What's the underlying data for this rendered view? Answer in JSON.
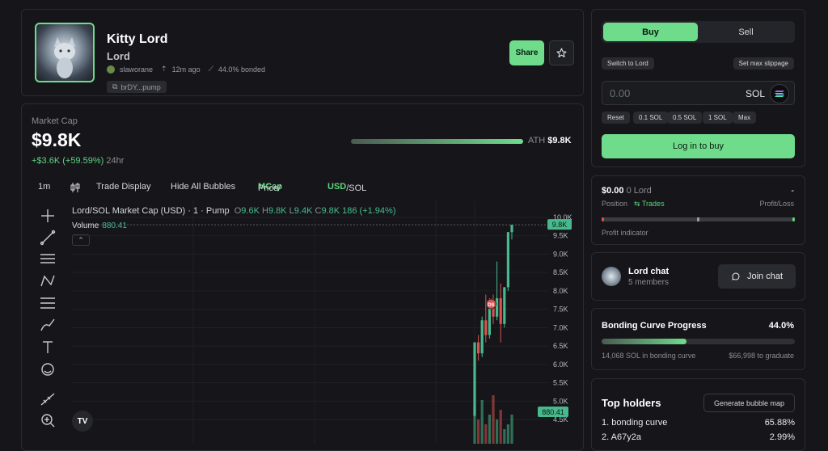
{
  "token": {
    "name": "Kitty Lord",
    "symbol": "Lord",
    "creator": "slaworane",
    "age": "12m ago",
    "bonded": "44.0% bonded",
    "address": "brDY...pump",
    "share_label": "Share"
  },
  "market": {
    "label": "Market Cap",
    "value": "$9.8K",
    "change": "+$3.6K (+59.59%)",
    "period": "24hr",
    "ath_label": "ATH",
    "ath_value": "$9.8K"
  },
  "toolbar": {
    "interval": "1m",
    "trade_display": "Trade Display",
    "hide_bubbles": "Hide All Bubbles",
    "price_label": "Price/",
    "mcap_label": "MCap",
    "usd_label": "USD",
    "sol_label": "/SOL"
  },
  "chart_data": {
    "type": "candlestick",
    "title": "Lord/SOL Market Cap (USD) · 1 · Pump",
    "ohlc": {
      "o_label": "O",
      "o": "9.6K",
      "h_label": "H",
      "h": "9.8K",
      "l_label": "L",
      "l": "9.4K",
      "c_label": "C",
      "c": "9.8K",
      "change": "186 (+1.94%)"
    },
    "volume_label": "Volume",
    "volume": "880.41",
    "y_ticks": [
      "10.0K",
      "9.5K",
      "9.0K",
      "8.5K",
      "8.0K",
      "7.5K",
      "7.0K",
      "6.5K",
      "6.0K",
      "5.5K",
      "5.0K",
      "4.5K"
    ],
    "y_min": 4.5,
    "y_max": 10.0,
    "last_price_tag": "9.8K",
    "volume_tag": "880.41",
    "bubble_label": "DS",
    "candles": [
      {
        "o": 4.6,
        "h": 6.6,
        "l": 4.6,
        "c": 6.6
      },
      {
        "o": 6.6,
        "h": 6.8,
        "l": 6.1,
        "c": 6.3
      },
      {
        "o": 6.3,
        "h": 7.3,
        "l": 6.2,
        "c": 7.2
      },
      {
        "o": 7.2,
        "h": 7.9,
        "l": 6.6,
        "c": 6.8
      },
      {
        "o": 6.8,
        "h": 7.8,
        "l": 6.7,
        "c": 7.6
      },
      {
        "o": 7.6,
        "h": 7.9,
        "l": 7.1,
        "c": 7.3
      },
      {
        "o": 7.3,
        "h": 8.8,
        "l": 7.2,
        "c": 7.8
      },
      {
        "o": 7.8,
        "h": 8.2,
        "l": 6.6,
        "c": 7.1
      },
      {
        "o": 7.1,
        "h": 8.1,
        "l": 7.0,
        "c": 8.1
      },
      {
        "o": 8.1,
        "h": 9.6,
        "l": 8.0,
        "c": 9.6
      },
      {
        "o": 9.6,
        "h": 9.8,
        "l": 9.4,
        "c": 9.8
      }
    ],
    "volumes": [
      0.8,
      0.5,
      0.9,
      0.4,
      0.6,
      1.0,
      0.5,
      0.7,
      0.3,
      0.4,
      0.6
    ],
    "up_color": "#47b98d",
    "down_color": "#d9534f"
  },
  "trade": {
    "buy_label": "Buy",
    "sell_label": "Sell",
    "switch_label": "Switch to Lord",
    "slippage_label": "Set max slippage",
    "amount_placeholder": "0.00",
    "currency": "SOL",
    "presets": [
      "Reset",
      "0.1 SOL",
      "0.5 SOL",
      "1 SOL",
      "Max"
    ],
    "login_label": "Log in to buy"
  },
  "position": {
    "value": "$0.00",
    "amount": "0 Lord",
    "pl_value": "-",
    "position_label": "Position",
    "trades_label": "Trades",
    "pl_label": "Profit/Loss",
    "indicator_label": "Profit indicator"
  },
  "chat": {
    "name": "Lord chat",
    "members": "5 members",
    "join_label": "Join chat"
  },
  "bonding": {
    "title": "Bonding Curve Progress",
    "percent": "44.0%",
    "progress": 0.44,
    "sol_in_curve": "14,068 SOL in bonding curve",
    "to_graduate": "$66,998 to graduate"
  },
  "holders": {
    "title": "Top holders",
    "bubble_map_label": "Generate bubble map",
    "rows": [
      {
        "label": "1. bonding curve",
        "pct": "65.88%"
      },
      {
        "label": "2. A67y2a",
        "pct": "2.99%"
      }
    ]
  },
  "colors": {
    "accent": "#6fdc8c",
    "background": "#16161a",
    "panel_border": "#2a2b30"
  }
}
